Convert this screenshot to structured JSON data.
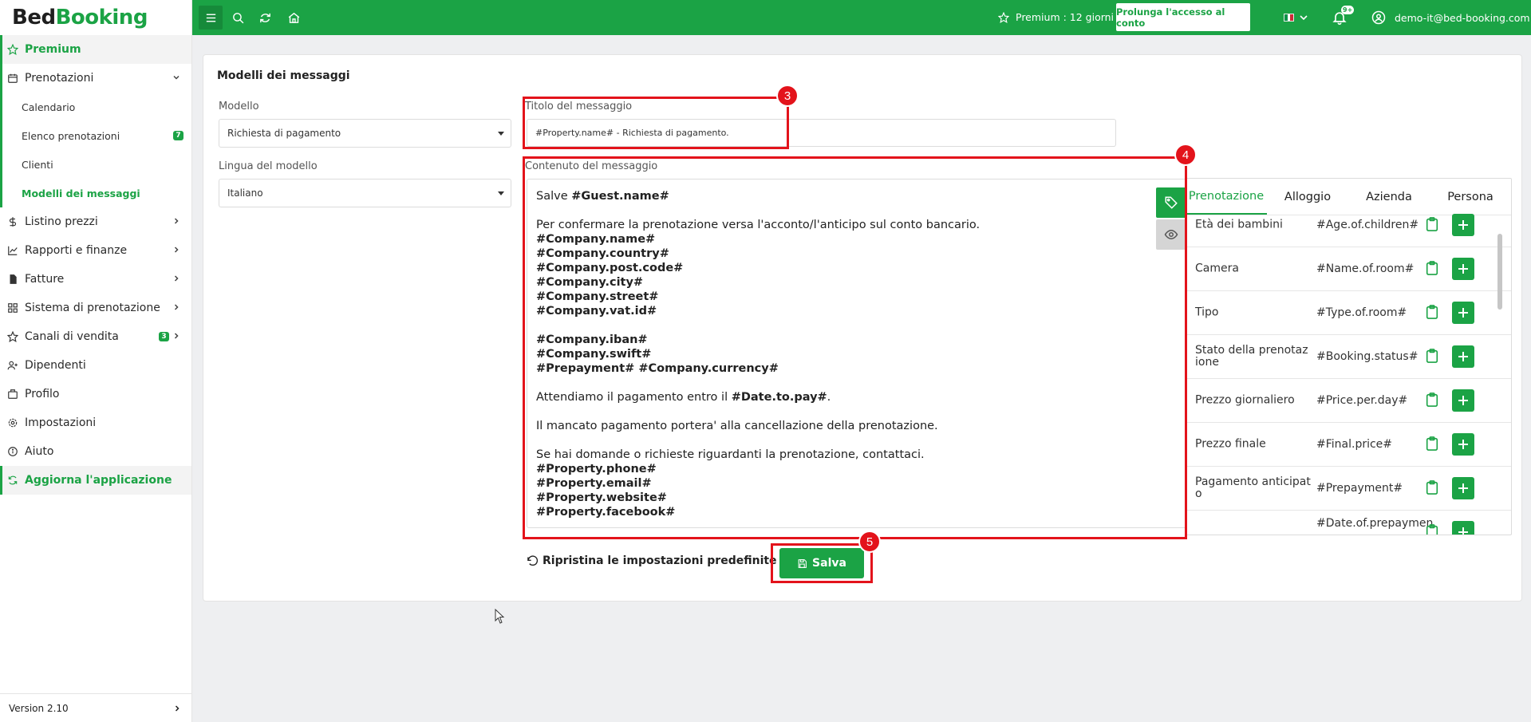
{
  "brand": {
    "part1": "Bed",
    "part2": "Booking"
  },
  "sidebar": {
    "premium": "Premium",
    "bookings": "Prenotazioni",
    "sub": [
      {
        "label": "Calendario"
      },
      {
        "label": "Elenco prenotazioni",
        "badge": "7"
      },
      {
        "label": "Clienti"
      },
      {
        "label": "Modelli dei messaggi"
      }
    ],
    "items": [
      {
        "label": "Listino prezzi"
      },
      {
        "label": "Rapporti e finanze"
      },
      {
        "label": "Fatture"
      },
      {
        "label": "Sistema di prenotazione"
      },
      {
        "label": "Canali di vendita",
        "badge": "3"
      },
      {
        "label": "Dipendenti"
      },
      {
        "label": "Profilo"
      },
      {
        "label": "Impostazioni"
      },
      {
        "label": "Aiuto"
      }
    ],
    "update": "Aggiorna l'applicazione",
    "version": "Version 2.10"
  },
  "topbar": {
    "premium": "Premium : 12 giorni",
    "extend": "Prolunga l'accesso al conto",
    "notif_badge": "9+",
    "user": "demo-it@bed-booking.com"
  },
  "page": {
    "title": "Modelli dei messaggi",
    "model_label": "Modello",
    "model_value": "Richiesta di pagamento",
    "lang_label": "Lingua del modello",
    "lang_value": "Italiano",
    "msg_title_label": "Titolo del messaggio",
    "msg_title_value": "#Property.name# - Richiesta di pagamento.",
    "content_label": "Contenuto del messaggio",
    "content": {
      "l1a": "Salve ",
      "l1b": "#Guest.name#",
      "l2": "Per confermare la prenotazione versa l'acconto/l'anticipo sul conto bancario.",
      "c1": "#Company.name#",
      "c2": "#Company.country#",
      "c3": "#Company.post.code#",
      "c4": "#Company.city#",
      "c5": "#Company.street#",
      "c6": "#Company.vat.id#",
      "c7": "#Company.iban#",
      "c8": "#Company.swift#",
      "c9": "#Prepayment# #Company.currency#",
      "l3a": "Attendiamo il pagamento entro il ",
      "l3b": "#Date.to.pay#",
      "l3c": ".",
      "l4": "Il mancato pagamento portera' alla cancellazione della prenotazione.",
      "l5": "Se hai domande o richieste riguardanti la prenotazione, contattaci.",
      "p1": "#Property.phone#",
      "p2": "#Property.email#",
      "p3": "#Property.website#",
      "p4": "#Property.facebook#"
    },
    "tabs": [
      "Prenotazione",
      "Alloggio",
      "Azienda",
      "Persona"
    ],
    "variables": [
      {
        "name": "Età dei bambini",
        "code": "#Age.of.children#"
      },
      {
        "name": "Camera",
        "code": "#Name.of.room#"
      },
      {
        "name": "Tipo",
        "code": "#Type.of.room#"
      },
      {
        "name": "Stato della prenotazione",
        "code": "#Booking.status#"
      },
      {
        "name": "Prezzo giornaliero",
        "code": "#Price.per.day#"
      },
      {
        "name": "Prezzo finale",
        "code": "#Final.price#"
      },
      {
        "name": "Pagamento anticipato",
        "code": "#Prepayment#"
      },
      {
        "name": "",
        "code": "#Date.of.prepaymen"
      }
    ],
    "restore": "Ripristina le impostazioni predefinite",
    "save": "Salva",
    "markers": [
      "3",
      "4",
      "5"
    ]
  },
  "colors": {
    "brand_green": "#1ba345",
    "annotation_red": "#e3131b"
  }
}
